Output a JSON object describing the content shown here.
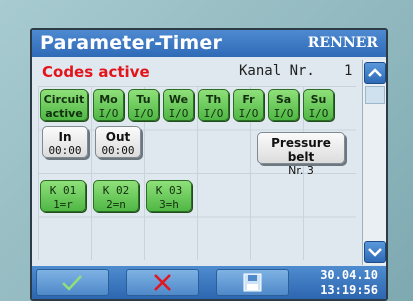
{
  "header": {
    "title": "Parameter-Timer",
    "brand": "RENNER"
  },
  "status": {
    "codes_active": "Codes active",
    "kanal_label": "Kanal Nr.",
    "kanal_value": "1"
  },
  "circuit": {
    "line1": "Circuit",
    "line2": "active"
  },
  "days": [
    {
      "name": "Mo",
      "state": "I/O"
    },
    {
      "name": "Tu",
      "state": "I/O"
    },
    {
      "name": "We",
      "state": "I/O"
    },
    {
      "name": "Th",
      "state": "I/O"
    },
    {
      "name": "Fr",
      "state": "I/O"
    },
    {
      "name": "Sa",
      "state": "I/O"
    },
    {
      "name": "Su",
      "state": "I/O"
    }
  ],
  "times": {
    "in": {
      "label": "In",
      "value": "00:00"
    },
    "out": {
      "label": "Out",
      "value": "00:00"
    }
  },
  "pressure_belt": {
    "label": "Pressure belt",
    "value": "Nr. 3"
  },
  "codes": [
    {
      "code": "K 01",
      "value": "1=r"
    },
    {
      "code": "K 02",
      "value": "2=n"
    },
    {
      "code": "K 03",
      "value": "3=h"
    }
  ],
  "footer": {
    "date": "30.04.10",
    "time": "13:19:56"
  },
  "icons": {
    "up": "chevron-up-icon",
    "down": "chevron-down-icon",
    "confirm": "checkmark-icon",
    "cancel": "cross-icon",
    "save": "floppy-icon"
  },
  "colors": {
    "title_bar": "#2f6ab8",
    "active_button": "#4fb744",
    "alert_text": "#e4141c"
  }
}
